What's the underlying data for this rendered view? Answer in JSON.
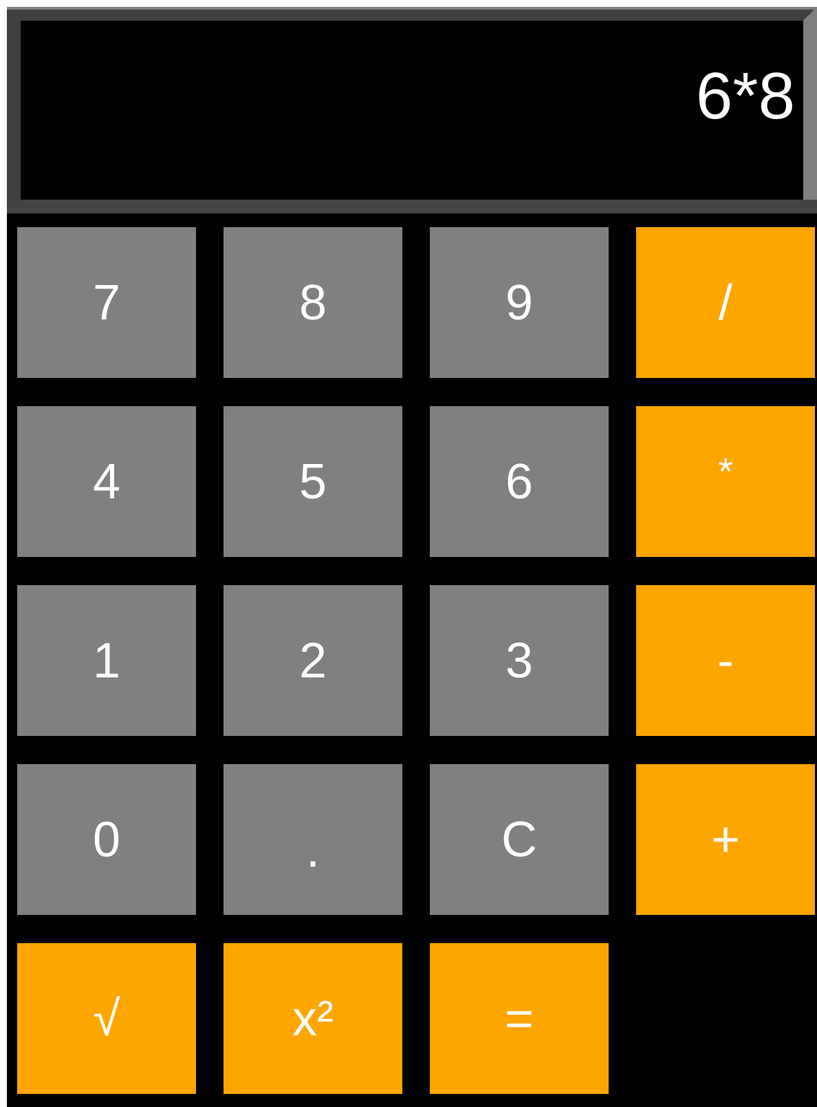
{
  "display": {
    "value": "6*8"
  },
  "keys": {
    "row1": {
      "k1": "7",
      "k2": "8",
      "k3": "9",
      "k4": "/"
    },
    "row2": {
      "k1": "4",
      "k2": "5",
      "k3": "6",
      "k4": "*"
    },
    "row3": {
      "k1": "1",
      "k2": "2",
      "k3": "3",
      "k4": "-"
    },
    "row4": {
      "k1": "0",
      "k2": ".",
      "k3": "C",
      "k4": "+"
    },
    "row5": {
      "k1": "√",
      "k2": "x²",
      "k3": "="
    }
  },
  "colors": {
    "background": "#000000",
    "number_key": "#808080",
    "operator_key": "#ffa500",
    "text": "#ffffff",
    "display_frame_dark": "#404040",
    "display_frame_light": "#7f7f7f"
  }
}
